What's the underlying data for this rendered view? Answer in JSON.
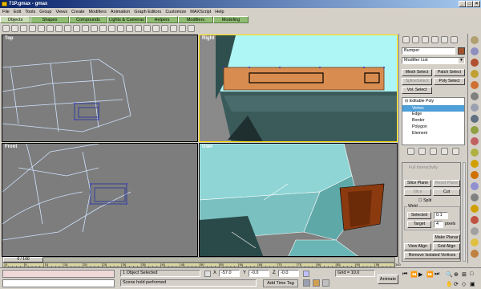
{
  "window": {
    "title": "71P.gmax - gmax",
    "minimize": "_",
    "maximize": "□",
    "close": "×"
  },
  "menu": [
    "File",
    "Edit",
    "Tools",
    "Group",
    "Views",
    "Create",
    "Modifiers",
    "Animation",
    "Graph Editors",
    "Customize",
    "MAXScript",
    "Help"
  ],
  "tabs": [
    "Objects",
    "Shapes",
    "Compounds",
    "Lights & Cameras",
    "Helpers",
    "Modifiers",
    "Modeling"
  ],
  "viewports": {
    "top": "Top",
    "right": "Right",
    "front": "Front",
    "user": "User"
  },
  "command_panel": {
    "object_name": "Bumper",
    "object_color": "#a0522d",
    "modifier_list": "Modifier List",
    "buttons": {
      "mesh_select": "Mesh Select",
      "patch_select": "Patch Select",
      "spline_select": "SplineSelect",
      "poly_select": "Poly Select",
      "vol_select": "Vol. Select"
    },
    "stack": {
      "root": "Editable Poly",
      "items": [
        "Vertex",
        "Edge",
        "Border",
        "Polygon",
        "Element"
      ],
      "selected_index": 0
    },
    "rollout": {
      "header": "Full Interactivity",
      "slice_plane": "Slice Plane",
      "reset_plane": "Reset Plane",
      "slice": "Slice",
      "cut": "Cut",
      "split": "Split",
      "weld_group": "Weld",
      "selected": "Selected",
      "selected_value": "0.1",
      "target": "Target",
      "target_value": "4",
      "pixels": "pixels",
      "make_planar": "Make Planar",
      "view_align": "View Align",
      "grid_align": "Grid Align",
      "remove_isolated": "Remove Isolated Vertices"
    }
  },
  "timeline": {
    "frame": "0 / 100",
    "ticks": [
      "0",
      "5",
      "10",
      "15",
      "20",
      "25",
      "30",
      "35",
      "40",
      "45",
      "50",
      "55",
      "60",
      "65",
      "70",
      "75",
      "80",
      "85",
      "90",
      "95",
      "100"
    ]
  },
  "status": {
    "objects_selected": "1 Object Selected",
    "prompt": "Scene hold performed",
    "add_time_tag": "Add Time Tag",
    "x_label": "X",
    "x_value": "-57.0",
    "y_label": "Y",
    "y_value": "-0.0",
    "z_label": "Z",
    "z_value": "-0.0",
    "grid": "Grid = 10.0",
    "animate": "Animate"
  }
}
